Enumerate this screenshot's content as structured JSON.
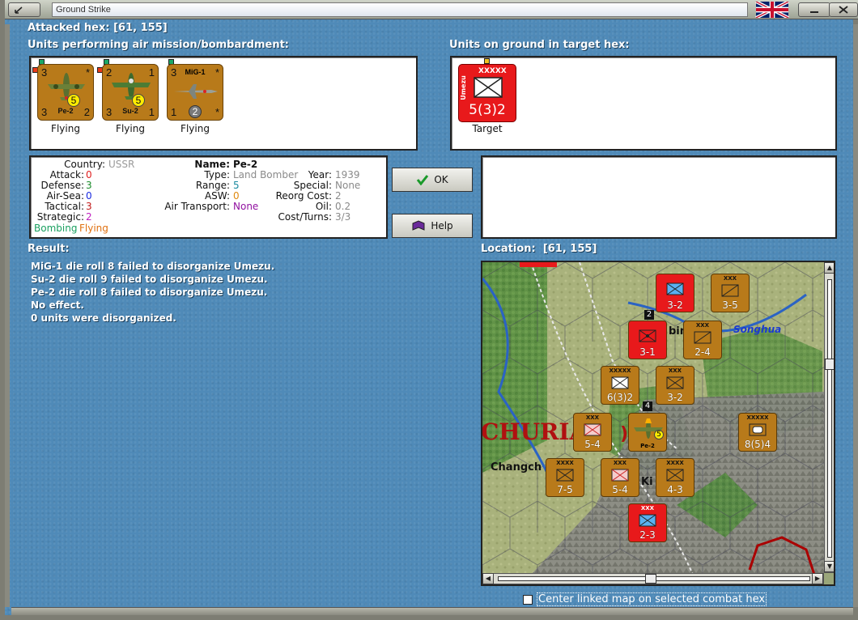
{
  "window": {
    "title": "Ground Strike"
  },
  "attacked_hex": {
    "label": "Attacked hex:",
    "coords": "[61, 155]"
  },
  "air_units": {
    "label": "Units performing air mission/bombardment:",
    "units": [
      {
        "name": "Pe-2",
        "tl": "3",
        "tr": "*",
        "bl": "3",
        "br": "2",
        "badge": "5",
        "status": "Flying"
      },
      {
        "name": "Su-2",
        "tl": "2",
        "tr": "1",
        "bl": "3",
        "br": "1",
        "badge": "5",
        "status": "Flying"
      },
      {
        "name": "MiG-1",
        "tl": "3",
        "tr": "*",
        "bl": "1",
        "br": "*",
        "badge": "2",
        "status": "Flying"
      }
    ]
  },
  "ground_units": {
    "label": "Units on ground in target hex:",
    "units": [
      {
        "name": "Umezu",
        "size": "XXXXX",
        "strength": "5(3)2",
        "status": "Target"
      }
    ]
  },
  "info": {
    "country_k": "Country:",
    "country_v": "USSR",
    "attack_k": "Attack:",
    "attack_v": "0",
    "defense_k": "Defense:",
    "defense_v": "3",
    "airsea_k": "Air-Sea:",
    "airsea_v": "0",
    "tactical_k": "Tactical:",
    "tactical_v": "3",
    "strategic_k": "Strategic:",
    "strategic_v": "2",
    "bombing": "Bombing",
    "flying": "Flying",
    "name_k": "Name:",
    "name_v": "Pe-2",
    "type_k": "Type:",
    "type_v": "Land Bomber",
    "range_k": "Range:",
    "range_v": "5",
    "asw_k": "ASW:",
    "asw_v": "0",
    "airtransport_k": "Air Transport:",
    "airtransport_v": "None",
    "year_k": "Year:",
    "year_v": "1939",
    "special_k": "Special:",
    "special_v": "None",
    "reorg_k": "Reorg Cost:",
    "reorg_v": "2",
    "oil_k": "Oil:",
    "oil_v": "0.2",
    "cost_k": "Cost/Turns:",
    "cost_v": "3/3"
  },
  "buttons": {
    "ok": "OK",
    "help": "Help"
  },
  "result": {
    "label": "Result:",
    "lines": [
      "MiG-1 die roll 8 failed to disorganize Umezu.",
      "Su-2 die roll 9 failed to disorganize Umezu.",
      "Pe-2 die roll 8 failed to disorganize Umezu.",
      "No effect.",
      "0 units were disorganized."
    ]
  },
  "location": {
    "label": "Location:",
    "coords": "[61, 155]"
  },
  "map": {
    "places": {
      "manchuria": "CHURIA",
      "changch": "Changch",
      "songhua": "Songhua",
      "bin": "bin",
      "ki": "Ki"
    },
    "counters": [
      {
        "str": "3-2",
        "size": "",
        "color": "red"
      },
      {
        "str": "3-5",
        "size": "XXX",
        "color": "brown"
      },
      {
        "str": "3-1",
        "size": "",
        "color": "red"
      },
      {
        "str": "2-4",
        "size": "XXX",
        "color": "brown"
      },
      {
        "str": "6(3)2",
        "size": "XXXXX",
        "color": "brown"
      },
      {
        "str": "3-2",
        "size": "XXX",
        "color": "brown"
      },
      {
        "str": "5-4",
        "size": "XXX",
        "color": "brown"
      },
      {
        "str": "8(5)4",
        "size": "XXXXX",
        "color": "brown"
      },
      {
        "str": "7-5",
        "size": "XXXX",
        "color": "brown"
      },
      {
        "str": "5-4",
        "size": "XXX",
        "color": "brown"
      },
      {
        "str": "4-3",
        "size": "XXXX",
        "color": "brown"
      },
      {
        "str": "2-3",
        "size": "XXX",
        "color": "red"
      }
    ],
    "stack_counts": [
      "2",
      "4"
    ],
    "plane_badge": "5",
    "plane_name": "Pe-2"
  },
  "checkbox": {
    "label": "Center linked map on selected combat hex",
    "checked": false
  }
}
